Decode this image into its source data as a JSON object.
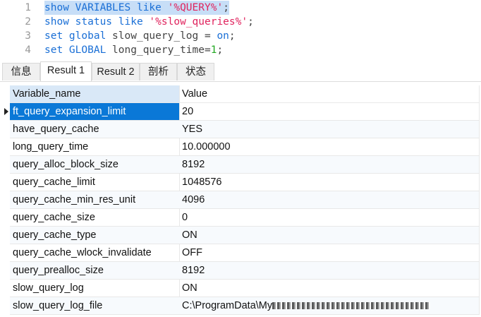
{
  "editor": {
    "lines": [
      {
        "num": "1",
        "parts": [
          "show",
          " VARIABLES",
          " like",
          " '%QUERY%'",
          ";"
        ]
      },
      {
        "num": "2",
        "parts": [
          "show",
          " status",
          " like",
          " '%slow_queries%'",
          ";"
        ]
      },
      {
        "num": "3",
        "parts": [
          "set",
          " global",
          " slow_query_log = ",
          "on",
          ";"
        ]
      },
      {
        "num": "4",
        "parts": [
          "set",
          " GLOBAL",
          " long_query_time=",
          "1",
          ";"
        ]
      }
    ]
  },
  "tabs": [
    "信息",
    "Result 1",
    "Result 2",
    "剖析",
    "状态"
  ],
  "table": {
    "headers": [
      "Variable_name",
      "Value"
    ],
    "rows": [
      [
        "ft_query_expansion_limit",
        "20"
      ],
      [
        "have_query_cache",
        "YES"
      ],
      [
        "long_query_time",
        "10.000000"
      ],
      [
        "query_alloc_block_size",
        "8192"
      ],
      [
        "query_cache_limit",
        "1048576"
      ],
      [
        "query_cache_min_res_unit",
        "4096"
      ],
      [
        "query_cache_size",
        "0"
      ],
      [
        "query_cache_type",
        "ON"
      ],
      [
        "query_cache_wlock_invalidate",
        "OFF"
      ],
      [
        "query_prealloc_size",
        "8192"
      ],
      [
        "slow_query_log",
        "ON"
      ],
      [
        "slow_query_log_file",
        "C:\\ProgramData\\My"
      ]
    ]
  }
}
